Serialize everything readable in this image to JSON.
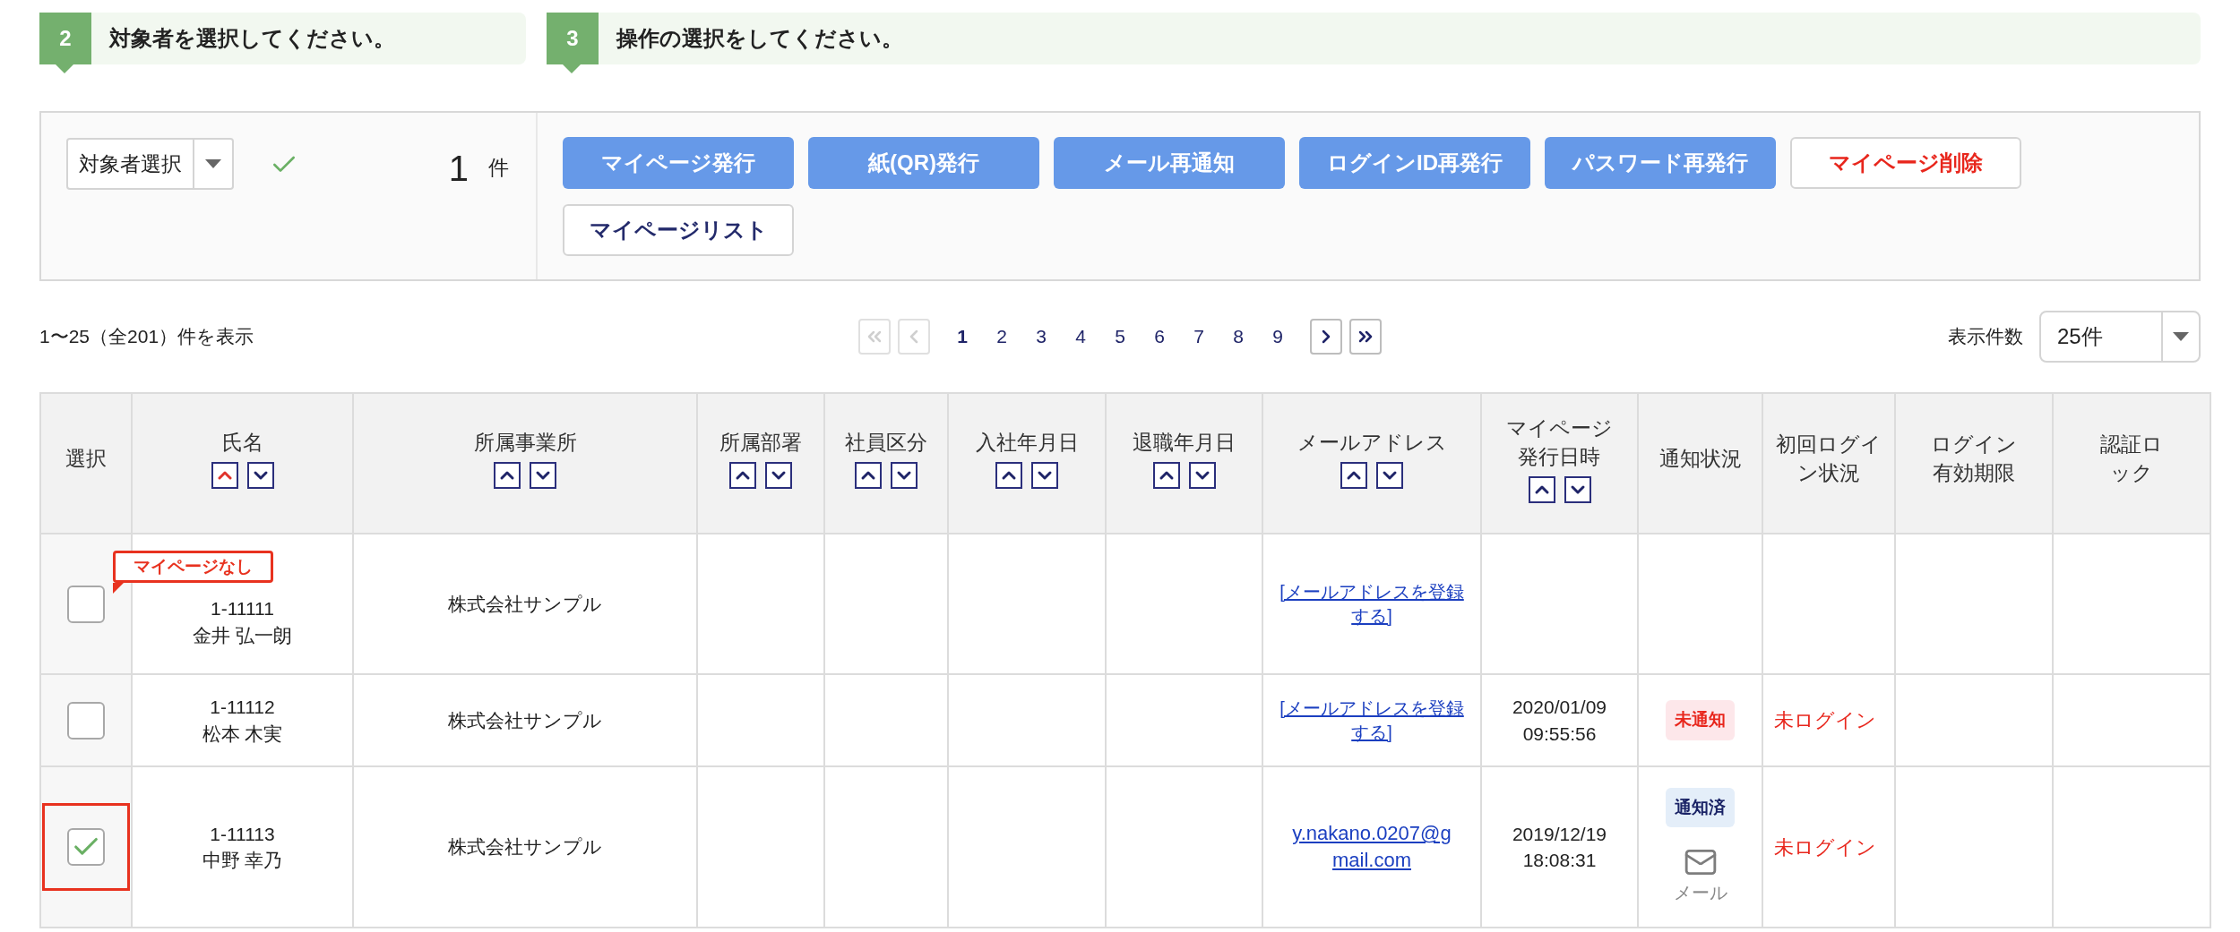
{
  "steps": [
    {
      "number": "2",
      "text": "対象者を選択してください。"
    },
    {
      "number": "3",
      "text": "操作の選択をしてください。"
    }
  ],
  "selector": {
    "value": "対象者選択",
    "confirmed": true,
    "count": "1",
    "unit": "件"
  },
  "actions": [
    {
      "label": "マイページ発行",
      "kind": "primary"
    },
    {
      "label": "紙(QR)発行",
      "kind": "primary"
    },
    {
      "label": "メール再通知",
      "kind": "primary"
    },
    {
      "label": "ログインID再発行",
      "kind": "primary"
    },
    {
      "label": "パスワード再発行",
      "kind": "primary"
    },
    {
      "label": "マイページ削除",
      "kind": "danger"
    },
    {
      "label": "マイページリスト",
      "kind": "outline"
    }
  ],
  "summary": "1〜25（全201）件を表示",
  "pagination": {
    "first_disabled": true,
    "prev_disabled": true,
    "next_disabled": false,
    "last_disabled": false,
    "pages": [
      {
        "label": "1",
        "selected": true
      },
      {
        "label": "2",
        "selected": false
      },
      {
        "label": "3",
        "selected": false
      },
      {
        "label": "4",
        "selected": false
      },
      {
        "label": "5",
        "selected": false
      },
      {
        "label": "6",
        "selected": false
      },
      {
        "label": "7",
        "selected": false
      },
      {
        "label": "8",
        "selected": false
      },
      {
        "label": "9",
        "selected": false
      }
    ]
  },
  "per_page": {
    "label": "表示件数",
    "value": "25件"
  },
  "table": {
    "columns": [
      {
        "label": "選択"
      },
      {
        "label": "氏名",
        "ascending_active": true
      },
      {
        "label": "所属事業所",
        "ascending_active": false
      },
      {
        "label": "所属部署",
        "ascending_active": false
      },
      {
        "label": "社員区分",
        "ascending_active": false
      },
      {
        "label": "入社年月日",
        "ascending_active": false
      },
      {
        "label": "退職年月日",
        "ascending_active": false
      },
      {
        "label": "メールアドレス",
        "ascending_active": false
      },
      {
        "label": "マイページ発行日時",
        "ascending_active": false
      },
      {
        "label": "通知状況"
      },
      {
        "label": "初回ログイン状況"
      },
      {
        "label": "ログイン有効期限"
      },
      {
        "label": "認証ロック"
      }
    ],
    "rows": [
      {
        "checked": false,
        "highlighted": false,
        "badge": "マイページなし",
        "id": "1-11111",
        "name": "金井 弘一朗",
        "office": "株式会社サンプル",
        "email": {
          "text": "[メールアドレスを登録する]",
          "kind": "register"
        }
      },
      {
        "checked": false,
        "highlighted": false,
        "id": "1-11112",
        "name": "松本 木実",
        "office": "株式会社サンプル",
        "email": {
          "text": "[メールアドレスを登録する]",
          "kind": "register"
        },
        "issued_date": "2020/01/09",
        "issued_time": "09:55:56",
        "notice": {
          "label": "未通知",
          "kind": "pending"
        },
        "login": "未ログイン"
      },
      {
        "checked": true,
        "highlighted": true,
        "id": "1-11113",
        "name": "中野 幸乃",
        "office": "株式会社サンプル",
        "email": {
          "text": "y.nakano.0207@gmail.com",
          "kind": "address"
        },
        "issued_date": "2019/12/19",
        "issued_time": "18:08:31",
        "notice": {
          "label": "通知済",
          "kind": "sent",
          "mail_label": "メール"
        },
        "login": "未ログイン"
      }
    ]
  }
}
